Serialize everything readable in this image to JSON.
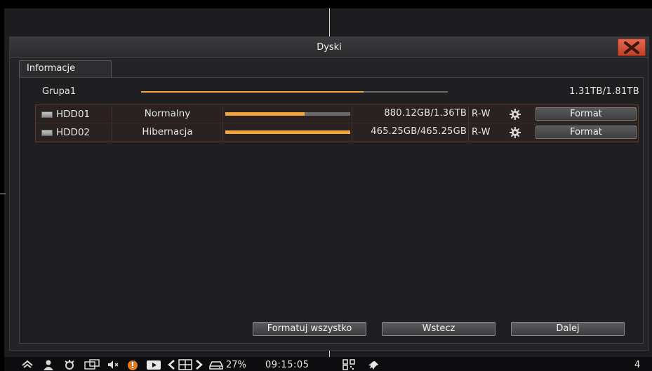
{
  "window": {
    "title": "Dyski"
  },
  "tabs": [
    {
      "label": "Informacje"
    }
  ],
  "group": {
    "label": "Grupa1",
    "size": "1.31TB/1.81TB",
    "usage_fraction": 0.725
  },
  "disks": [
    {
      "name": "HDD01",
      "status": "Normalny",
      "usage_fraction": 0.635,
      "size": "880.12GB/1.36TB",
      "mode": "R-W",
      "format_label": "Format"
    },
    {
      "name": "HDD02",
      "status": "Hibernacja",
      "usage_fraction": 1.0,
      "size": "465.25GB/465.25GB",
      "mode": "R-W",
      "format_label": "Format"
    }
  ],
  "footer": {
    "format_all_label": "Formatuj wszystko",
    "back_label": "Wstecz",
    "next_label": "Dalej"
  },
  "taskbar": {
    "record_percent": "27%",
    "time": "09:15:05",
    "channel": "4"
  },
  "colors": {
    "accent": "#f3a43a",
    "close": "#d4533a"
  },
  "icons": [
    "home-icon",
    "user-icon",
    "alarm-icon",
    "multiscreen-icon",
    "mute-icon",
    "warning-icon",
    "playback-icon",
    "prev-icon",
    "layout-grid-icon",
    "next-icon",
    "disk-status-icon",
    "qr-code-icon",
    "pin-icon",
    "gear-icon",
    "hdd-icon",
    "close-icon"
  ]
}
